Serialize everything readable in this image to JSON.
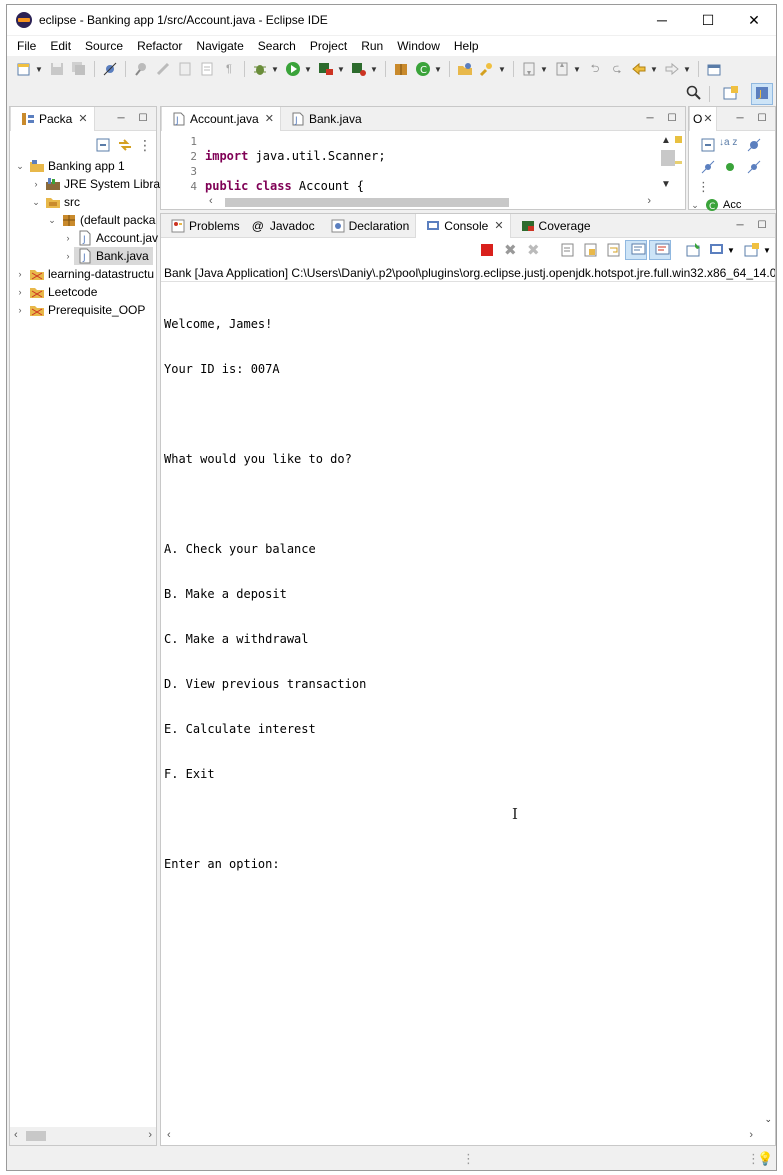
{
  "window": {
    "title": "eclipse - Banking app 1/src/Account.java - Eclipse IDE",
    "controls": {
      "minimize": "─",
      "maximize": "☐",
      "close": "✕"
    }
  },
  "menu": [
    "File",
    "Edit",
    "Source",
    "Refactor",
    "Navigate",
    "Search",
    "Project",
    "Run",
    "Window",
    "Help"
  ],
  "explorer": {
    "tab_label": "Packa",
    "tree": [
      {
        "label": "Banking app 1",
        "twisty": "⌄",
        "icon": "project-icon"
      },
      {
        "label": "JRE System Librar",
        "twisty": "›",
        "icon": "library-icon"
      },
      {
        "label": "src",
        "twisty": "⌄",
        "icon": "source-folder-icon"
      },
      {
        "label": "(default packa",
        "twisty": "⌄",
        "icon": "package-icon"
      },
      {
        "label": "Account.jav",
        "twisty": "›",
        "icon": "java-file-icon"
      },
      {
        "label": "Bank.java",
        "twisty": "›",
        "icon": "java-file-icon"
      },
      {
        "label": "learning-datastructu",
        "twisty": "›",
        "icon": "project-icon"
      },
      {
        "label": "Leetcode",
        "twisty": "›",
        "icon": "project-icon"
      },
      {
        "label": "Prerequisite_OOP",
        "twisty": "›",
        "icon": "project-icon"
      }
    ]
  },
  "editor": {
    "tabs": [
      {
        "label": "Account.java",
        "active": true
      },
      {
        "label": "Bank.java",
        "active": false
      }
    ],
    "line_numbers": [
      "1",
      "2",
      "3",
      "4"
    ],
    "lines": {
      "l2_kw": "import",
      "l2_rest": " java.util.Scanner;",
      "l4_kw": "public class",
      "l4_rest": " Account {"
    }
  },
  "outline": {
    "tab_label": "O",
    "item_label": "Acc"
  },
  "console": {
    "tabs": [
      "Problems",
      "Javadoc",
      "Declaration",
      "Console",
      "Coverage"
    ],
    "tab_icons": {
      "javadoc": "@"
    },
    "header": "Bank [Java Application] C:\\Users\\Daniy\\.p2\\pool\\plugins\\org.eclipse.justj.openjdk.hotspot.jre.full.win32.x86_64_14.0.",
    "output": [
      "Welcome, James!",
      "Your ID is: 007A",
      "",
      "What would you like to do?",
      "",
      "A. Check your balance",
      "B. Make a deposit",
      "C. Make a withdrawal",
      "D. View previous transaction",
      "E. Calculate interest",
      "F. Exit",
      "",
      "Enter an option:"
    ]
  },
  "colors": {
    "keyword": "#7f0055",
    "terminate_red": "#d9201c",
    "selection": "#d9d9d9"
  }
}
